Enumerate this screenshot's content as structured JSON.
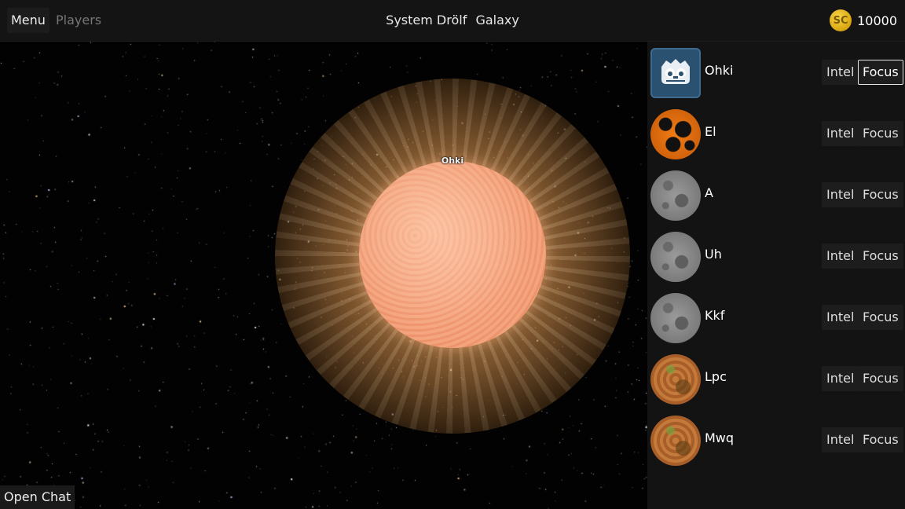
{
  "topbar": {
    "menu_label": "Menu",
    "players_label": "Players",
    "system_label": "System Drölf",
    "galaxy_label": "Galaxy",
    "credits_icon_label": "SC",
    "credits_value": "10000",
    "credits_icon": "credits-coin-icon"
  },
  "star": {
    "label": "Ohki"
  },
  "players": [
    {
      "name": "Ohki",
      "avatar": "godot-icon",
      "intel_label": "Intel",
      "focus_label": "Focus",
      "focused": true
    },
    {
      "name": "El",
      "avatar": "lava-planet-icon",
      "intel_label": "Intel",
      "focus_label": "Focus",
      "focused": false
    },
    {
      "name": "A",
      "avatar": "moon-planet-icon",
      "intel_label": "Intel",
      "focus_label": "Focus",
      "focused": false
    },
    {
      "name": "Uh",
      "avatar": "moon-planet-icon",
      "intel_label": "Intel",
      "focus_label": "Focus",
      "focused": false
    },
    {
      "name": "Kkf",
      "avatar": "moon-planet-icon",
      "intel_label": "Intel",
      "focus_label": "Focus",
      "focused": false
    },
    {
      "name": "Lpc",
      "avatar": "earth-planet-icon",
      "intel_label": "Intel",
      "focus_label": "Focus",
      "focused": false
    },
    {
      "name": "Mwq",
      "avatar": "earth-planet-icon",
      "intel_label": "Intel",
      "focus_label": "Focus",
      "focused": false
    }
  ],
  "chat": {
    "open_label": "Open Chat"
  },
  "colors": {
    "panel_bg": "#131313",
    "button_bg": "#1d1d1d",
    "coin": "#e3b51c",
    "star_core": "#f2a07a"
  }
}
